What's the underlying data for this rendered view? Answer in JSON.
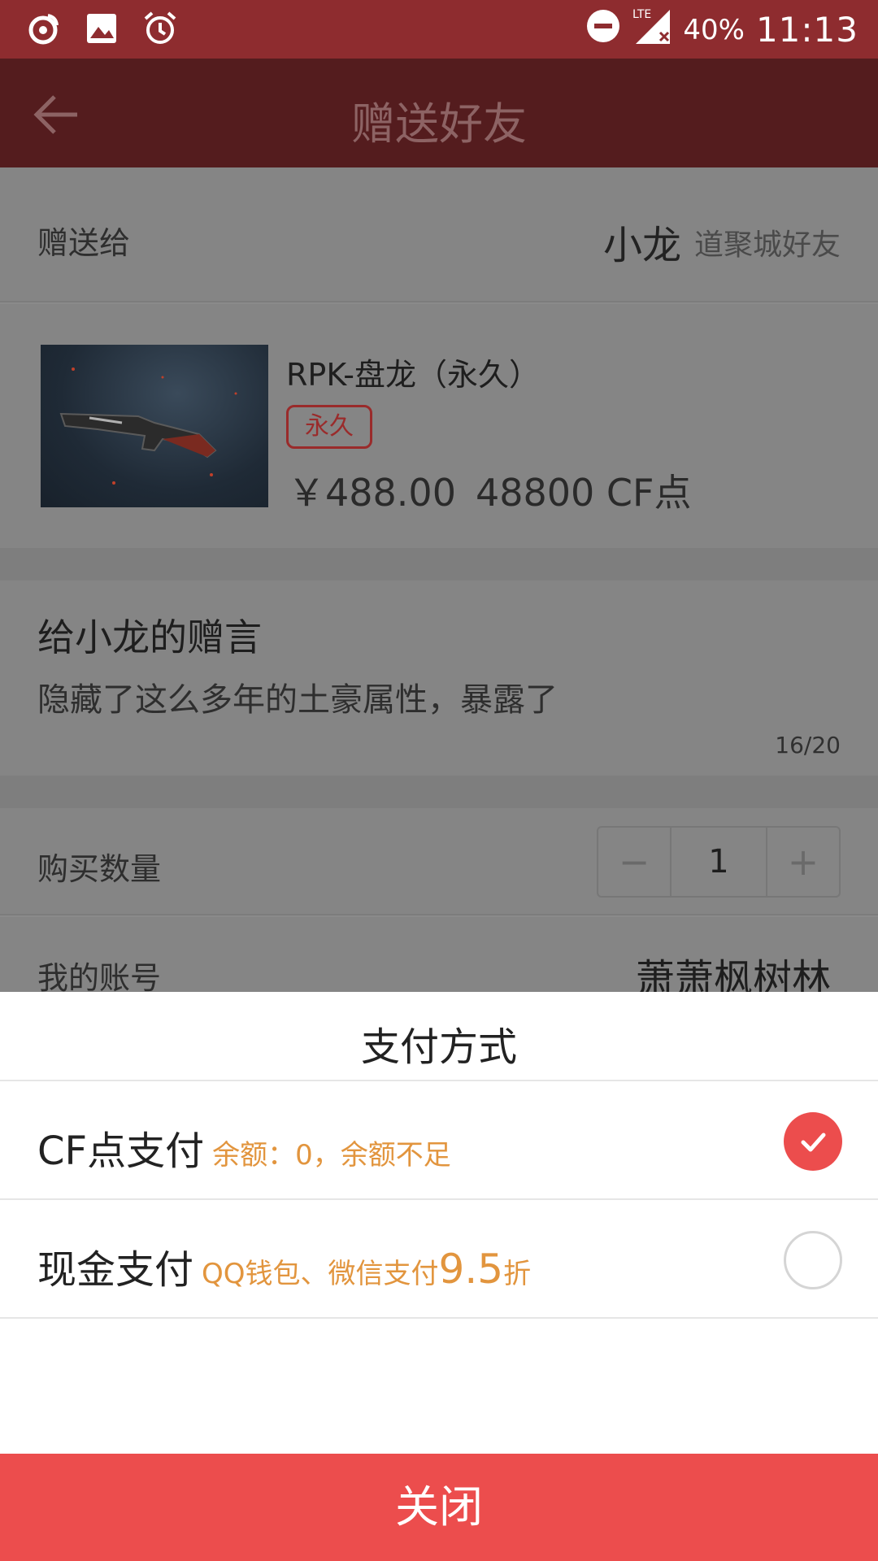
{
  "status_bar": {
    "battery": "40%",
    "time": "11:13",
    "network": "LTE",
    "icons": [
      "weibo-icon",
      "gallery-icon",
      "alarm-icon",
      "do-not-disturb-icon",
      "signal-icon"
    ]
  },
  "app_bar": {
    "title": "赠送好友",
    "back_icon": "arrow-left-icon"
  },
  "recipient": {
    "label": "赠送给",
    "name": "小龙",
    "tag": "道聚城好友"
  },
  "product": {
    "name": "RPK-盘龙（永久）",
    "badge": "永久",
    "price_cny": "￥488.00",
    "price_cf": "48800 CF点"
  },
  "message": {
    "title": "给小龙的赠言",
    "text": "隐藏了这么多年的土豪属性，暴露了",
    "count": "16/20"
  },
  "quantity": {
    "label": "购买数量",
    "minus": "−",
    "value": "1",
    "plus": "+"
  },
  "account": {
    "label": "我的账号",
    "value": "萧萧枫树林"
  },
  "payment_sheet": {
    "title": "支付方式",
    "options": [
      {
        "label": "CF点支付",
        "note": "余额：0，余额不足",
        "selected": true
      },
      {
        "label": "现金支付",
        "note": "QQ钱包、微信支付",
        "discount_value": "9.5",
        "discount_unit": "折",
        "selected": false
      }
    ],
    "close_label": "关闭"
  },
  "colors": {
    "accent_red": "#ec4d4d",
    "note_orange": "#e2953e",
    "status_bar": "#8e2c2f",
    "app_bar": "#541c1e"
  }
}
